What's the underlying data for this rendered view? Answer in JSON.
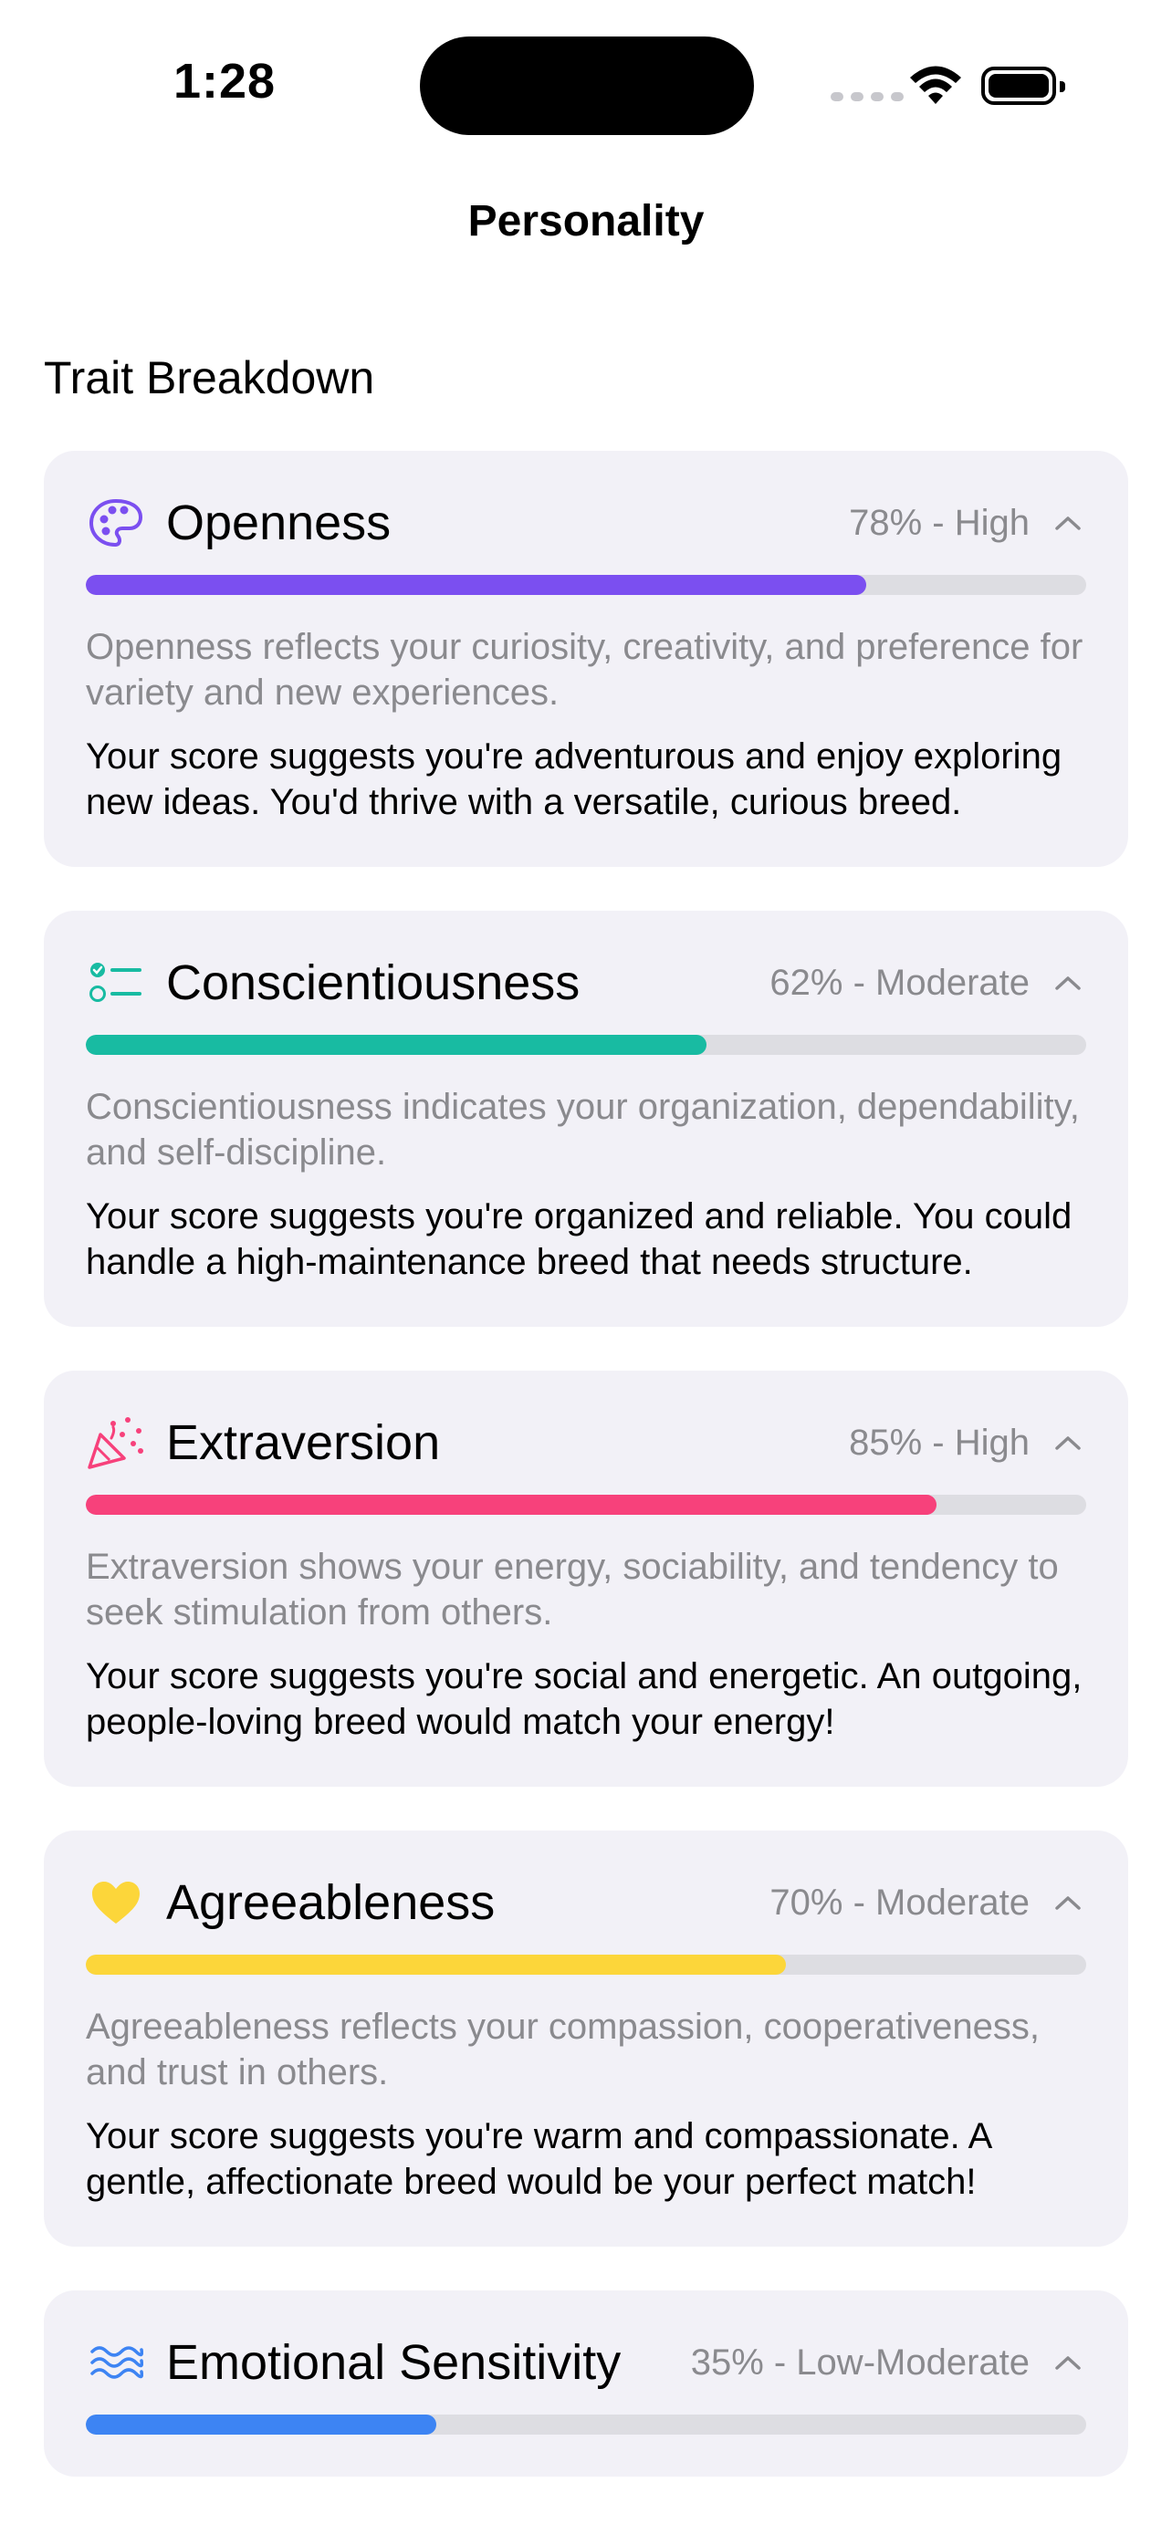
{
  "status": {
    "time": "1:28"
  },
  "nav": {
    "title": "Personality"
  },
  "section": {
    "title": "Trait Breakdown"
  },
  "traits": [
    {
      "name": "Openness",
      "score": "78% - High",
      "value": 0.78,
      "color": "#7b4ff0",
      "icon": "palette-icon",
      "description": "Openness reflects your curiosity, creativity, and preference for variety and new experiences.",
      "detail": "Your score suggests you're adventurous and enjoy exploring new ideas. You'd thrive with a versatile, curious breed."
    },
    {
      "name": "Conscientiousness",
      "score": "62% - Moderate",
      "value": 0.62,
      "color": "#18bba2",
      "icon": "checklist-icon",
      "description": "Conscientiousness indicates your organization, dependability, and self-discipline.",
      "detail": "Your score suggests you're organized and reliable. You could handle a high-maintenance breed that needs structure."
    },
    {
      "name": "Extraversion",
      "score": "85% - High",
      "value": 0.85,
      "color": "#f7417b",
      "icon": "party-popper-icon",
      "description": "Extraversion shows your energy, sociability, and tendency to seek stimulation from others.",
      "detail": "Your score suggests you're social and energetic. An outgoing, people-loving breed would match your energy!"
    },
    {
      "name": "Agreeableness",
      "score": "70% - Moderate",
      "value": 0.7,
      "color": "#fcd63a",
      "icon": "heart-icon",
      "description": "Agreeableness reflects your compassion, cooperativeness, and trust in others.",
      "detail": "Your score suggests you're warm and compassionate. A gentle, affectionate breed would be your perfect match!"
    },
    {
      "name": "Emotional Sensitivity",
      "score": "35% - Low-Moderate",
      "value": 0.35,
      "color": "#3d84f3",
      "icon": "waves-icon",
      "description": "",
      "detail": ""
    }
  ]
}
